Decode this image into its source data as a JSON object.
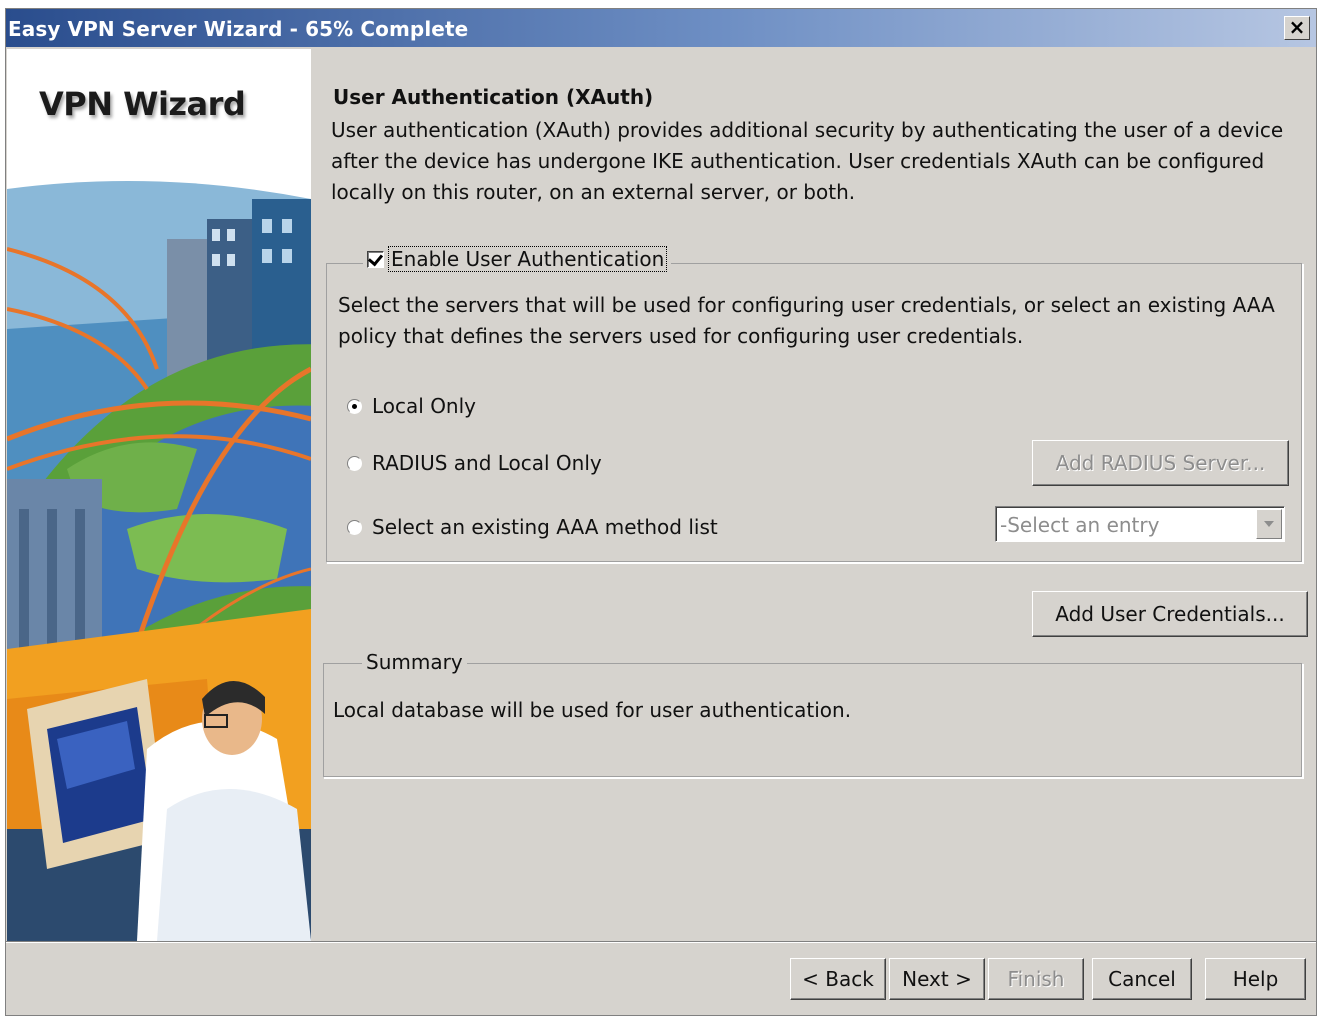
{
  "window": {
    "title": "Easy VPN Server Wizard - 65% Complete",
    "close_symbol": "×"
  },
  "sidebar": {
    "title": "VPN Wizard",
    "illustration": "vpn-wizard-illustration"
  },
  "main": {
    "section_title": "User Authentication (XAuth)",
    "section_description": "User authentication (XAuth) provides additional security by authenticating the user of a device after the device has undergone IKE authentication. User credentials XAuth can be configured locally on this router, on an external server, or both.",
    "enable_auth": {
      "label": "Enable User Authentication",
      "checked": true
    },
    "auth_description": "Select the servers that will be used for configuring user credentials, or select an existing AAA policy that defines the servers used for configuring user credentials.",
    "options": [
      {
        "label": "Local Only",
        "selected": true
      },
      {
        "label": "RADIUS and Local Only",
        "selected": false
      },
      {
        "label": "Select an existing AAA method list",
        "selected": false
      }
    ],
    "add_radius_label": "Add RADIUS Server...",
    "aaa_select_value": "-Select an entry",
    "add_credentials_label": "Add User Credentials...",
    "summary": {
      "legend": "Summary",
      "text": "Local database will be used for user authentication."
    }
  },
  "footer": {
    "back_label": "< Back",
    "next_label": "Next >",
    "finish_label": "Finish",
    "cancel_label": "Cancel",
    "help_label": "Help"
  },
  "colors": {
    "window_bg": "#d6d3ce",
    "title_gradient_start": "#2a4d8d",
    "disabled_text": "#8d8d8d"
  }
}
